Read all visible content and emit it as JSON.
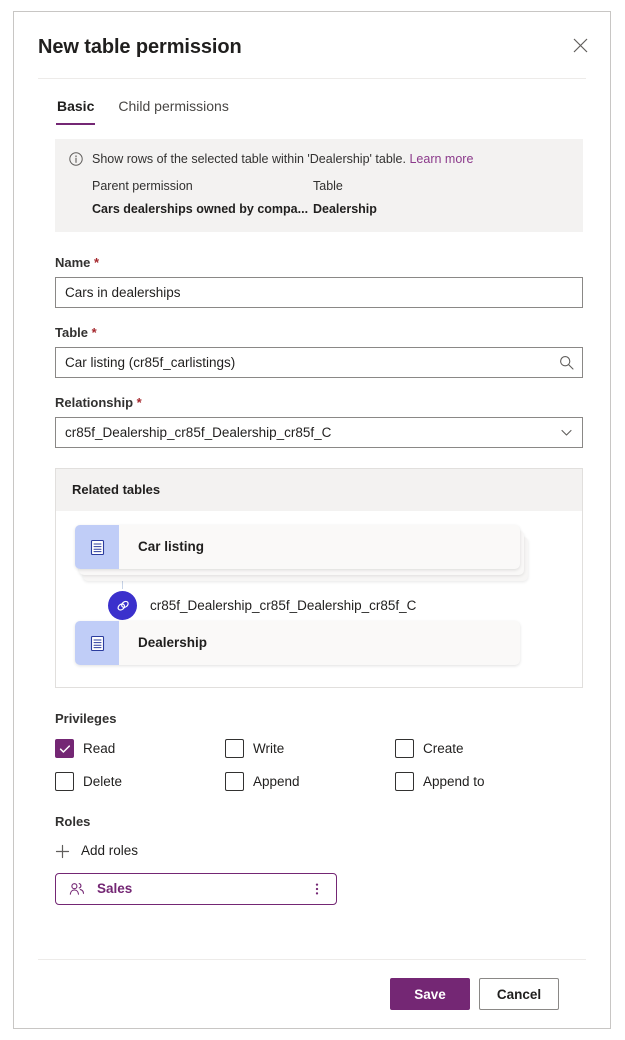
{
  "dialog": {
    "title": "New table permission",
    "close_icon": "close-icon"
  },
  "tabs": [
    {
      "label": "Basic",
      "active": true
    },
    {
      "label": "Child permissions",
      "active": false
    }
  ],
  "info_banner": {
    "icon": "info-circle-icon",
    "message": "Show rows of the selected table within 'Dealership' table.",
    "learn_more": "Learn more",
    "columns": [
      {
        "header": "Parent permission",
        "value": "Cars dealerships owned by compa..."
      },
      {
        "header": "Table",
        "value": "Dealership"
      }
    ]
  },
  "fields": {
    "name": {
      "label": "Name",
      "required_mark": "*",
      "value": "Cars in dealerships",
      "placeholder": "Name"
    },
    "table": {
      "label": "Table",
      "required_mark": "*",
      "value": "Car listing (cr85f_carlistings)",
      "placeholder": "Table",
      "icon": "search-icon"
    },
    "relationship": {
      "label": "Relationship",
      "required_mark": "*",
      "value": "cr85f_Dealership_cr85f_Dealership_cr85f_C",
      "placeholder": "Relationship",
      "icon": "chevron-down-icon"
    }
  },
  "related_tables": {
    "header": "Related tables",
    "source_card": {
      "name": "Car listing",
      "icon": "table-icon",
      "stacked": true
    },
    "relationship_node": {
      "label": "cr85f_Dealership_cr85f_Dealership_cr85f_C",
      "icon": "link-icon"
    },
    "target_card": {
      "name": "Dealership",
      "icon": "table-icon",
      "stacked": false
    }
  },
  "privileges": {
    "label": "Privileges",
    "items": [
      {
        "label": "Read",
        "checked": true
      },
      {
        "label": "Write",
        "checked": false
      },
      {
        "label": "Create",
        "checked": false
      },
      {
        "label": "Delete",
        "checked": false
      },
      {
        "label": "Append",
        "checked": false
      },
      {
        "label": "Append to",
        "checked": false
      }
    ]
  },
  "roles": {
    "label": "Roles",
    "add_label": "Add roles",
    "add_icon": "plus-icon",
    "items": [
      {
        "name": "Sales",
        "icon": "person-group-icon",
        "more_icon": "more-vertical-icon"
      }
    ]
  },
  "footer": {
    "save_label": "Save",
    "cancel_label": "Cancel"
  },
  "colors": {
    "accent": "#742774",
    "link": "#8b3a8b",
    "required": "#a4262c",
    "entity_icon_bg": "#c0cdf7",
    "relationship_node": "#3b30cc",
    "banner_bg": "#f3f2f1"
  }
}
